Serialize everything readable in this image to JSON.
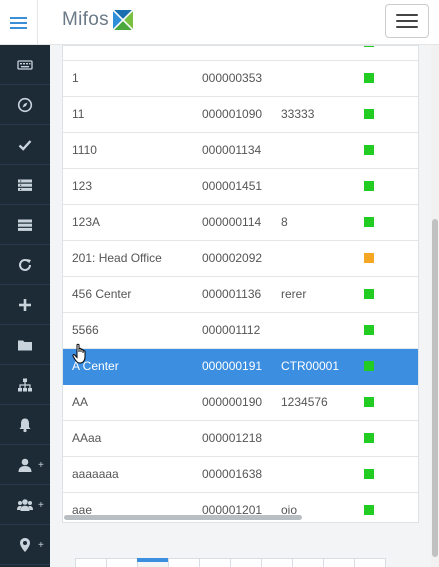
{
  "header": {
    "brand": "Mifos",
    "menu_toggle_icon": "hamburger-icon",
    "accent_color": "#3a8fd6"
  },
  "sidebar": {
    "items": [
      {
        "icon": "keyboard-icon",
        "plus": ""
      },
      {
        "icon": "compass-icon",
        "plus": ""
      },
      {
        "icon": "check-icon",
        "plus": ""
      },
      {
        "icon": "list-icon",
        "plus": ""
      },
      {
        "icon": "list-alt-icon",
        "plus": ""
      },
      {
        "icon": "refresh-icon",
        "plus": ""
      },
      {
        "icon": "plus-icon",
        "plus": ""
      },
      {
        "icon": "folder-icon",
        "plus": ""
      },
      {
        "icon": "sitemap-icon",
        "plus": ""
      },
      {
        "icon": "bell-icon",
        "plus": ""
      },
      {
        "icon": "user-icon",
        "plus": "+"
      },
      {
        "icon": "users-icon",
        "plus": "+"
      },
      {
        "icon": "map-marker-icon",
        "plus": "+"
      }
    ]
  },
  "table": {
    "status_colors": {
      "active": "#22cc22",
      "pending": "#f5a623"
    },
    "rows": [
      {
        "name": "1",
        "account": "000000353",
        "external_id": "",
        "status": "active",
        "selected": false
      },
      {
        "name": "11",
        "account": "000001090",
        "external_id": "33333",
        "status": "active",
        "selected": false
      },
      {
        "name": "1110",
        "account": "000001134",
        "external_id": "",
        "status": "active",
        "selected": false
      },
      {
        "name": "123",
        "account": "000001451",
        "external_id": "",
        "status": "active",
        "selected": false
      },
      {
        "name": "123A",
        "account": "000000114",
        "external_id": "8",
        "status": "active",
        "selected": false
      },
      {
        "name": "201: Head Office",
        "account": "000002092",
        "external_id": "",
        "status": "pending",
        "selected": false
      },
      {
        "name": "456 Center",
        "account": "000001136",
        "external_id": "rerer",
        "status": "active",
        "selected": false
      },
      {
        "name": "5566",
        "account": "000001112",
        "external_id": "",
        "status": "active",
        "selected": false
      },
      {
        "name": "A Center",
        "account": "000000191",
        "external_id": "CTR00001",
        "status": "active",
        "selected": true
      },
      {
        "name": "AA",
        "account": "000000190",
        "external_id": "1234576",
        "status": "active",
        "selected": false
      },
      {
        "name": "AAaa",
        "account": "000001218",
        "external_id": "",
        "status": "active",
        "selected": false
      },
      {
        "name": "aaaaaaa",
        "account": "000001638",
        "external_id": "",
        "status": "active",
        "selected": false
      },
      {
        "name": "aae",
        "account": "000001201",
        "external_id": "oio",
        "status": "active",
        "selected": false
      }
    ]
  }
}
